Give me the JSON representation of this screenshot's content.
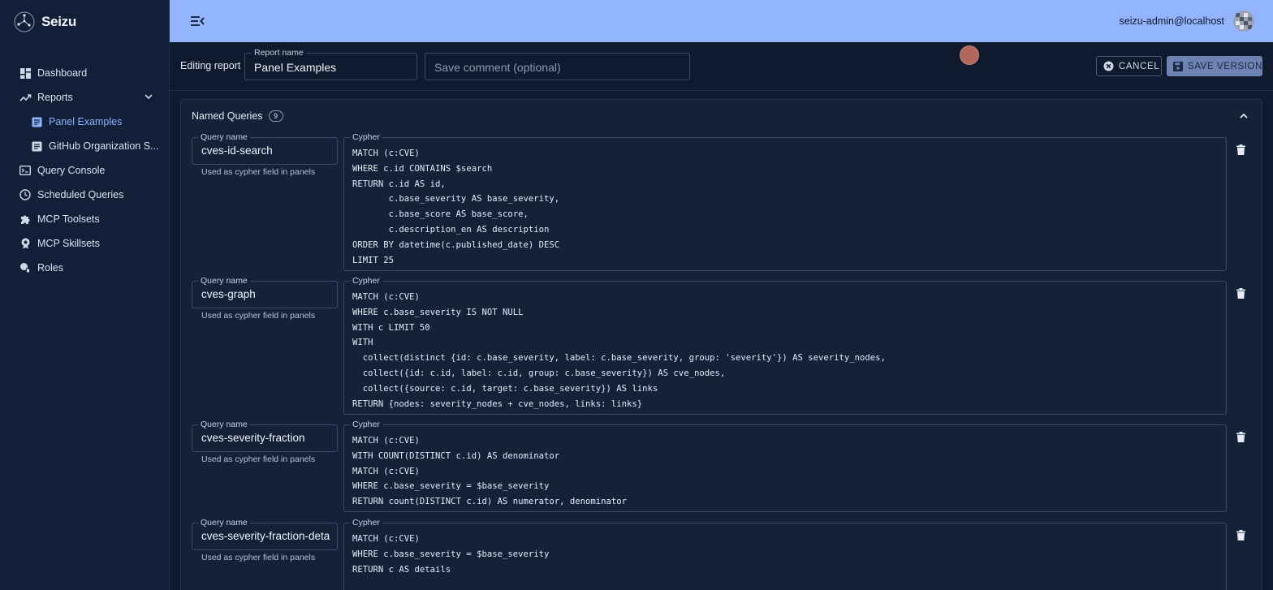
{
  "app": {
    "name": "Seizu"
  },
  "sidebar": {
    "items": [
      {
        "label": "Dashboard",
        "icon": "dashboard-icon"
      },
      {
        "label": "Reports",
        "icon": "trending-icon",
        "expanded": true
      },
      {
        "label": "Panel Examples",
        "icon": "document-icon",
        "active": true
      },
      {
        "label": "GitHub Organization S...",
        "icon": "document-icon"
      },
      {
        "label": "Query Console",
        "icon": "terminal-icon"
      },
      {
        "label": "Scheduled Queries",
        "icon": "clock-icon"
      },
      {
        "label": "MCP Toolsets",
        "icon": "puzzle-icon"
      },
      {
        "label": "MCP Skillsets",
        "icon": "badge-icon"
      },
      {
        "label": "Roles",
        "icon": "shield-user-icon"
      }
    ]
  },
  "topbar": {
    "user": "seizu-admin@localhost"
  },
  "editbar": {
    "label": "Editing report",
    "report_name_label": "Report name",
    "report_name_value": "Panel Examples",
    "comment_placeholder": "Save comment (optional)",
    "cancel_label": "CANCEL",
    "save_label": "SAVE VERSION"
  },
  "panel": {
    "title": "Named Queries",
    "count": "9",
    "queries": [
      {
        "name_label": "Query name",
        "name": "cves-id-search",
        "helper": "Used as cypher field in panels",
        "cypher_label": "Cypher",
        "cypher": "MATCH (c:CVE)\nWHERE c.id CONTAINS $search\nRETURN c.id AS id,\n       c.base_severity AS base_severity,\n       c.base_score AS base_score,\n       c.description_en AS description\nORDER BY datetime(c.published_date) DESC\nLIMIT 25"
      },
      {
        "name_label": "Query name",
        "name": "cves-graph",
        "helper": "Used as cypher field in panels",
        "cypher_label": "Cypher",
        "cypher": "MATCH (c:CVE)\nWHERE c.base_severity IS NOT NULL\nWITH c LIMIT 50\nWITH\n  collect(distinct {id: c.base_severity, label: c.base_severity, group: 'severity'}) AS severity_nodes,\n  collect({id: c.id, label: c.id, group: c.base_severity}) AS cve_nodes,\n  collect({source: c.id, target: c.base_severity}) AS links\nRETURN {nodes: severity_nodes + cve_nodes, links: links}"
      },
      {
        "name_label": "Query name",
        "name": "cves-severity-fraction",
        "helper": "Used as cypher field in panels",
        "cypher_label": "Cypher",
        "cypher": "MATCH (c:CVE)\nWITH COUNT(DISTINCT c.id) AS denominator\nMATCH (c:CVE)\nWHERE c.base_severity = $base_severity\nRETURN count(DISTINCT c.id) AS numerator, denominator"
      },
      {
        "name_label": "Query name",
        "name": "cves-severity-fraction-deta",
        "helper": "Used as cypher field in panels",
        "cypher_label": "Cypher",
        "cypher": "MATCH (c:CVE)\nWHERE c.base_severity = $base_severity\nRETURN c AS details"
      }
    ]
  }
}
